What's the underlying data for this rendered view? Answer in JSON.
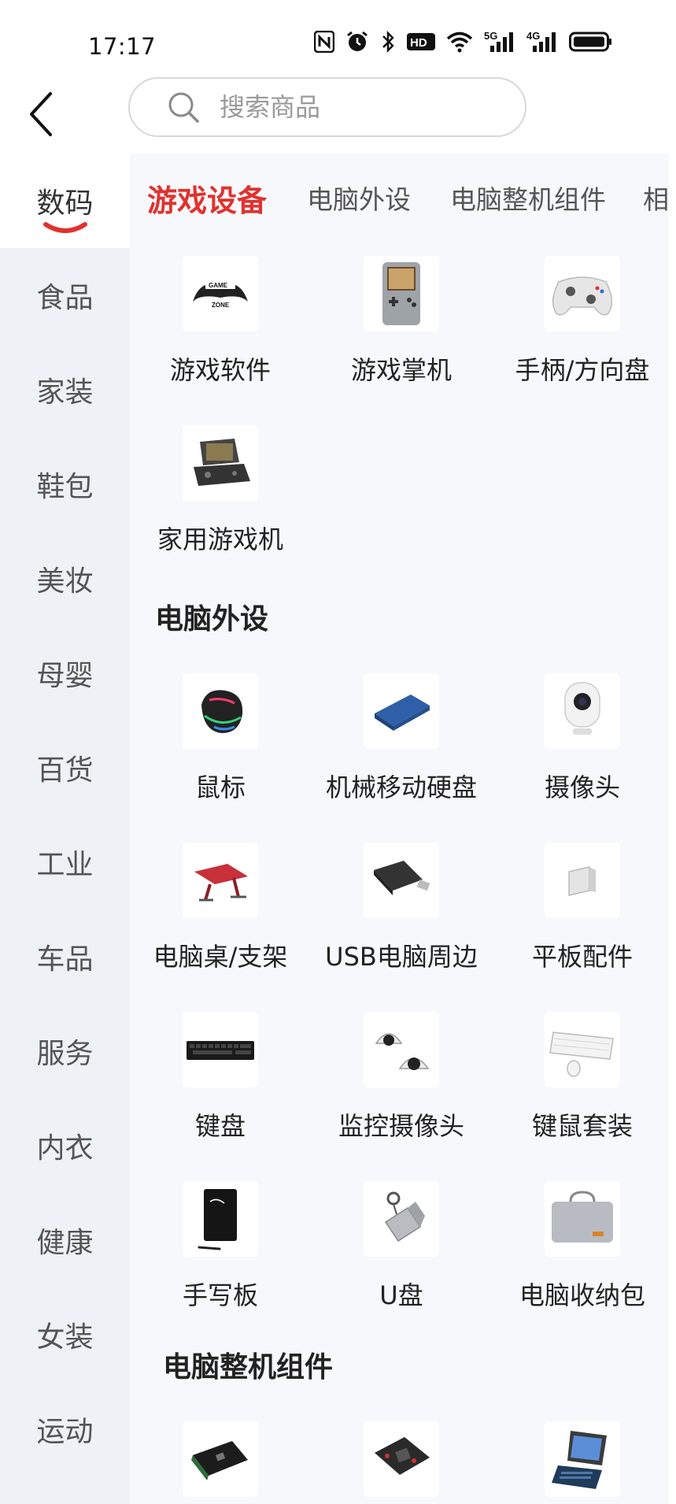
{
  "status_bar": {
    "time": "17:17",
    "icons": [
      "nfc-icon",
      "alarm-icon",
      "bluetooth-icon",
      "hd-icon",
      "wifi-icon",
      "signal-5g-icon",
      "signal-4g-icon",
      "battery-icon"
    ],
    "net1": "5G",
    "net2": "4G",
    "hd": "HD"
  },
  "header": {
    "search_placeholder": "搜索商品"
  },
  "sidebar": {
    "items": [
      {
        "label": "数码",
        "active": true
      },
      {
        "label": "食品"
      },
      {
        "label": "家装"
      },
      {
        "label": "鞋包"
      },
      {
        "label": "美妆"
      },
      {
        "label": "母婴"
      },
      {
        "label": "百货"
      },
      {
        "label": "工业"
      },
      {
        "label": "车品"
      },
      {
        "label": "服务"
      },
      {
        "label": "内衣"
      },
      {
        "label": "健康"
      },
      {
        "label": "女装"
      },
      {
        "label": "运动"
      }
    ]
  },
  "tabs": [
    {
      "label": "游戏设备",
      "active": true
    },
    {
      "label": "电脑外设"
    },
    {
      "label": "电脑整机组件"
    },
    {
      "label": "相"
    }
  ],
  "sections": [
    {
      "title": "",
      "items": [
        {
          "label": "游戏软件",
          "icon": "game-zone-logo-icon"
        },
        {
          "label": "游戏掌机",
          "icon": "handheld-console-icon"
        },
        {
          "label": "手柄/方向盘",
          "icon": "gamepad-icon"
        },
        {
          "label": "家用游戏机",
          "icon": "home-console-icon"
        }
      ]
    },
    {
      "title": "电脑外设",
      "items": [
        {
          "label": "鼠标",
          "icon": "mouse-icon"
        },
        {
          "label": "机械移动硬盘",
          "icon": "hard-drive-icon"
        },
        {
          "label": "摄像头",
          "icon": "webcam-icon"
        },
        {
          "label": "电脑桌/支架",
          "icon": "laptop-stand-icon"
        },
        {
          "label": "USB电脑周边",
          "icon": "usb-device-icon"
        },
        {
          "label": "平板配件",
          "icon": "tablet-accessory-icon"
        },
        {
          "label": "键盘",
          "icon": "keyboard-icon"
        },
        {
          "label": "监控摄像头",
          "icon": "cctv-camera-icon"
        },
        {
          "label": "键鼠套装",
          "icon": "keyboard-mouse-set-icon"
        },
        {
          "label": "手写板",
          "icon": "writing-tablet-icon"
        },
        {
          "label": "U盘",
          "icon": "usb-flash-drive-icon"
        },
        {
          "label": "电脑收纳包",
          "icon": "laptop-bag-icon"
        }
      ]
    },
    {
      "title": "电脑整机组件",
      "items": [
        {
          "icon": "graphics-card-icon"
        },
        {
          "icon": "motherboard-icon"
        },
        {
          "icon": "tablet-keyboard-case-icon"
        }
      ]
    }
  ],
  "colors": {
    "accent": "#e0322f",
    "sidebar_bg": "#eef1f6",
    "main_bg": "#f7f8fb"
  }
}
